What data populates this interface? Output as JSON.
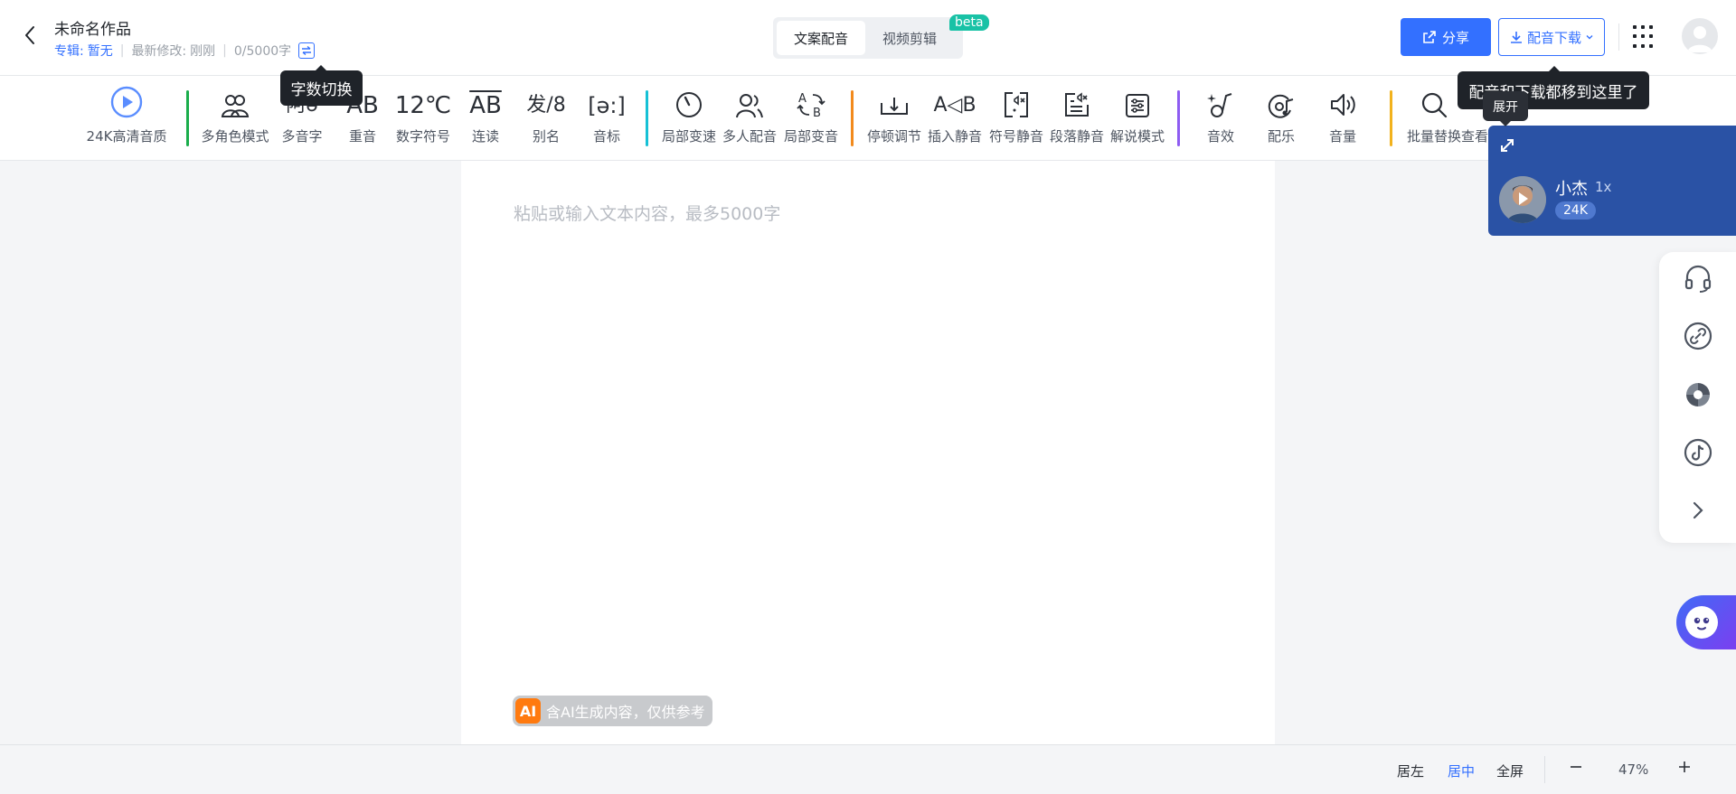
{
  "header": {
    "title": "未命名作品",
    "album_label": "专辑:",
    "album_value": "暂无",
    "modified_label": "最新修改:",
    "modified_value": "刚刚",
    "word_count": "0/5000字",
    "tabs": [
      {
        "label": "文案配音",
        "active": true
      },
      {
        "label": "视频剪辑",
        "active": false
      }
    ],
    "beta_badge": "beta",
    "share_label": "分享",
    "download_label": "配音下载"
  },
  "toolbar": {
    "items": [
      {
        "label": "24K高清音质",
        "icon": "play-circle-icon"
      },
      {
        "label": "多角色模式",
        "icon": "multi-role-icon"
      },
      {
        "label": "多音字",
        "icon": "polyphone-icon"
      },
      {
        "label": "重音",
        "icon": "stress-icon"
      },
      {
        "label": "数字符号",
        "icon": "number-symbol-icon",
        "glyph": "12℃"
      },
      {
        "label": "连读",
        "icon": "liaison-icon"
      },
      {
        "label": "别名",
        "icon": "alias-icon"
      },
      {
        "label": "音标",
        "icon": "phonetic-icon"
      },
      {
        "label": "局部变速",
        "icon": "speed-icon"
      },
      {
        "label": "多人配音",
        "icon": "multi-person-icon"
      },
      {
        "label": "局部变音",
        "icon": "voice-change-icon"
      },
      {
        "label": "停顿调节",
        "icon": "pause-adjust-icon"
      },
      {
        "label": "插入静音",
        "icon": "insert-silence-icon"
      },
      {
        "label": "符号静音",
        "icon": "symbol-silence-icon"
      },
      {
        "label": "段落静音",
        "icon": "paragraph-silence-icon"
      },
      {
        "label": "解说模式",
        "icon": "narration-icon"
      },
      {
        "label": "音效",
        "icon": "sound-effect-icon"
      },
      {
        "label": "配乐",
        "icon": "music-icon"
      },
      {
        "label": "音量",
        "icon": "volume-icon"
      },
      {
        "label": "批量替换",
        "icon": "search-icon"
      },
      {
        "label": "查看",
        "icon": "view-icon"
      }
    ],
    "divider_colors": [
      "#1aad4b",
      "#16c1d6",
      "#f28a1d",
      "#8e5cf2",
      "#f2b21d"
    ]
  },
  "editor": {
    "placeholder": "粘贴或输入文本内容，最多5000字",
    "ai_badge": "AI",
    "ai_notice": "含AI生成内容，仅供参考"
  },
  "tooltips": {
    "word_count_switch": "字数切换",
    "moved_here": "配音和下载都移到这里了",
    "expand": "展开"
  },
  "voice_card": {
    "name": "小杰",
    "speed": "1x",
    "quality": "24K"
  },
  "side_panel": {
    "icons": [
      "headset-icon",
      "link-icon",
      "swirl-icon",
      "tiktok-icon",
      "chevron-right-icon"
    ]
  },
  "bottom": {
    "align_left": "居左",
    "align_center": "居中",
    "fullscreen": "全屏",
    "zoom": "47%"
  },
  "colors": {
    "accent": "#3370ff",
    "voice_card_bg": "#2a52a5"
  }
}
